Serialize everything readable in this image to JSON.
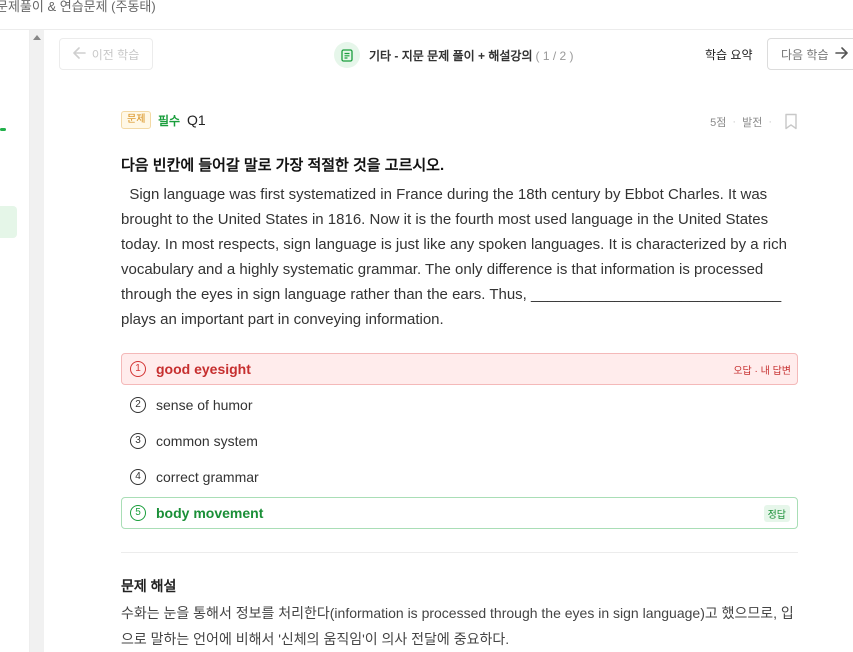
{
  "header": {
    "title": "문제풀이 & 연습문제 (주동태)"
  },
  "nav": {
    "prev_label": "이전 학습",
    "title": "기타 - 지문 문제 풀이 + 해설강의",
    "count": "( 1 / 2 )",
    "summary_label": "학습 요약",
    "next_label": "다음 학습"
  },
  "question": {
    "type_tag": "문제",
    "required_tag": "필수",
    "number": "Q1",
    "score": "5점",
    "level": "발전",
    "prompt": "다음 빈칸에 들어갈 말로 가장 적절한 것을 고르시오.",
    "passage": "  Sign language was first systematized in France during the 18th century by Ebbot Charles. It was brought to the United States in 1816. Now it is the fourth most used language in the United States today. In most respects, sign language is just like any spoken languages. It is characterized by a rich vocabulary and a highly systematic grammar. The only difference is that information is processed through the eyes in sign language rather than the ears. Thus, ______________________________ plays an important part in conveying information."
  },
  "choices": [
    {
      "num": "1",
      "text": "good eyesight",
      "state": "wrong",
      "badge": "오답 · 내 답변"
    },
    {
      "num": "2",
      "text": "sense of humor",
      "state": "normal",
      "badge": ""
    },
    {
      "num": "3",
      "text": "common system",
      "state": "normal",
      "badge": ""
    },
    {
      "num": "4",
      "text": "correct grammar",
      "state": "normal",
      "badge": ""
    },
    {
      "num": "5",
      "text": "body movement",
      "state": "right",
      "badge": "정답"
    }
  ],
  "explanation": {
    "title": "문제 해설",
    "body": "수화는 눈을 통해서 정보를 처리한다(information is processed through the eyes in sign language)고 했으므로, 입으로 말하는 언어에 비해서 '신체의 움직임'이 의사 전달에 중요하다."
  },
  "colors": {
    "accent": "#1a9e3c",
    "wrong": "#c62f2f",
    "wrong_bg": "#ffecec",
    "right_border": "#a9deb6"
  }
}
